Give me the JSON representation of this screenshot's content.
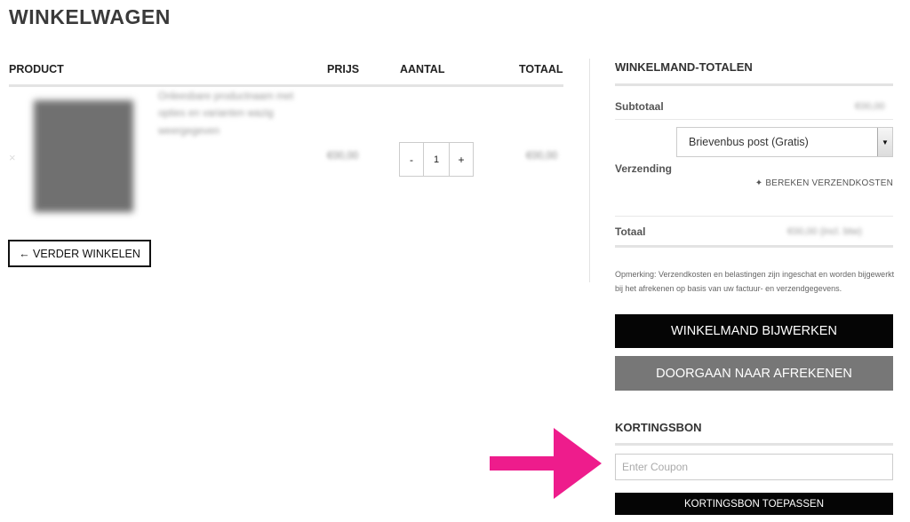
{
  "page": {
    "title": "WINKELWAGEN"
  },
  "cart": {
    "headers": {
      "product": "PRODUCT",
      "price": "PRIJS",
      "quantity": "AANTAL",
      "total": "TOTAAL"
    },
    "item": {
      "name": "Onleesbare productnaam met opties en varianten wazig weergegeven",
      "price": "€00,00",
      "quantity": "1",
      "subtotal": "€00,00",
      "minus_label": "-",
      "plus_label": "+",
      "remove_label": "×"
    },
    "continue_label": "← VERDER WINKELEN"
  },
  "totals": {
    "heading": "WINKELMAND-TOTALEN",
    "subtotal_label": "Subtotaal",
    "subtotal_value": "€00,00",
    "shipping_label": "Verzending",
    "shipping_option": "Brievenbus post (Gratis)",
    "calculate_label": "✦ BEREKEN VERZENDKOSTEN",
    "total_label": "Totaal",
    "total_value": "€00,00 (incl. btw)",
    "note": "Opmerking: Verzendkosten en belastingen zijn ingeschat en worden bijgewerkt bij het afrekenen op basis van uw factuur- en verzendgegevens.",
    "update_label": "WINKELMAND BIJWERKEN",
    "checkout_label": "DOORGAAN NAAR AFREKENEN"
  },
  "coupon": {
    "heading": "KORTINGSBON",
    "placeholder": "Enter Coupon",
    "apply_label": "KORTINGSBON TOEPASSEN"
  },
  "colors": {
    "arrow": "#ee1c8c",
    "primary_button": "#050505",
    "secondary_button": "#777777"
  },
  "icons": {
    "select": "chevron-down-icon",
    "callout": "arrow-right-icon"
  }
}
